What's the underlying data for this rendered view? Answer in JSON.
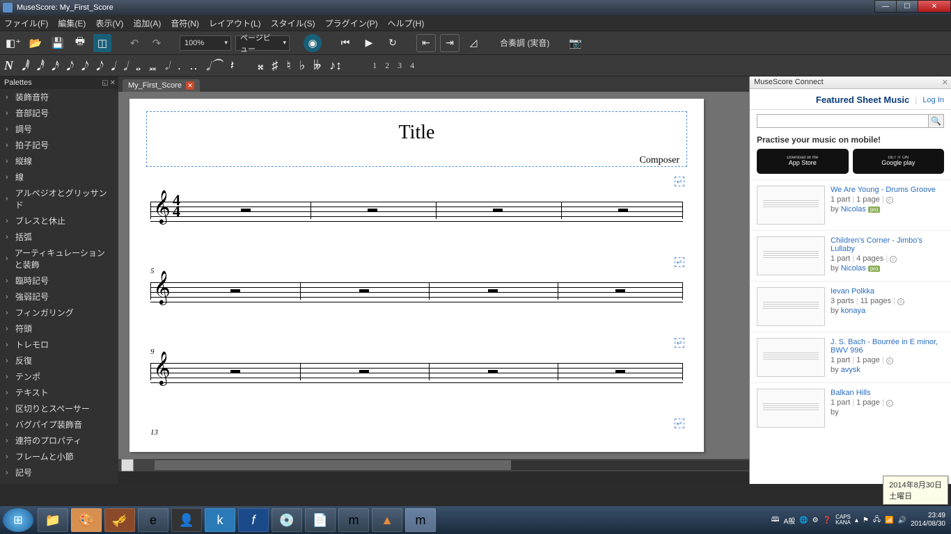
{
  "window": {
    "title": "MuseScore: My_First_Score"
  },
  "menu": {
    "file": "ファイル(F)",
    "edit": "編集(E)",
    "view": "表示(V)",
    "add": "追加(A)",
    "notes": "音符(N)",
    "layout": "レイアウト(L)",
    "style": "スタイル(S)",
    "plugins": "プラグイン(P)",
    "help": "ヘルプ(H)"
  },
  "toolbar": {
    "zoom": "100%",
    "viewmode": "ページビュー",
    "concert_pitch": "合奏調 (実音)"
  },
  "voices": {
    "v1": "1",
    "v2": "2",
    "v3": "3",
    "v4": "4"
  },
  "palettes": {
    "title": "Palettes",
    "items": [
      "装飾音符",
      "音部記号",
      "調号",
      "拍子記号",
      "縦線",
      "線",
      "アルペジオとグリッサンド",
      "ブレスと休止",
      "括弧",
      "アーティキュレーションと装飾",
      "臨時記号",
      "強弱記号",
      "フィンガリング",
      "符頭",
      "トレモロ",
      "反復",
      "テンポ",
      "テキスト",
      "区切りとスペーサー",
      "バグパイプ装飾音",
      "連符のプロパティ",
      "フレームと小節",
      "記号"
    ]
  },
  "tab": {
    "name": "My_First_Score"
  },
  "score": {
    "title": "Title",
    "composer": "Composer",
    "system2_num": "5",
    "system3_num": "9",
    "system4_num": "13"
  },
  "connect": {
    "panel_title": "MuseScore Connect",
    "header": "Featured Sheet Music",
    "login": "Log In",
    "promo": "Practise your music on mobile!",
    "appstore_small": "Download on the",
    "appstore": "App Store",
    "gplay_small": "GET IT ON",
    "gplay": "Google play",
    "items": [
      {
        "title": "We Are Young - Drums Groove",
        "parts": "1 part",
        "pages": "1 page",
        "by": "by ",
        "author": "Nicolas",
        "pro": true
      },
      {
        "title": "Children's Corner - Jimbo's Lullaby",
        "parts": "1 part",
        "pages": "4 pages",
        "by": "by ",
        "author": "Nicolas",
        "pro": true
      },
      {
        "title": "Ievan Polkka",
        "parts": "3 parts",
        "pages": "11 pages",
        "by": "by ",
        "author": "konaya",
        "pro": false
      },
      {
        "title": "J. S. Bach - Bourrée in E minor, BWV 996",
        "parts": "1 part",
        "pages": "1 page",
        "by": "by ",
        "author": "avysk",
        "pro": false
      },
      {
        "title": "Balkan Hills",
        "parts": "1 part",
        "pages": "1 page",
        "by": "by ",
        "author": "",
        "pro": false
      }
    ]
  },
  "tooltip": {
    "line1": "2014年8月30日",
    "line2": "土曜日"
  },
  "tray": {
    "ime": "A般",
    "caps": "CAPS",
    "kana": "KANA",
    "time": "23:49",
    "date": "2014/08/30"
  }
}
